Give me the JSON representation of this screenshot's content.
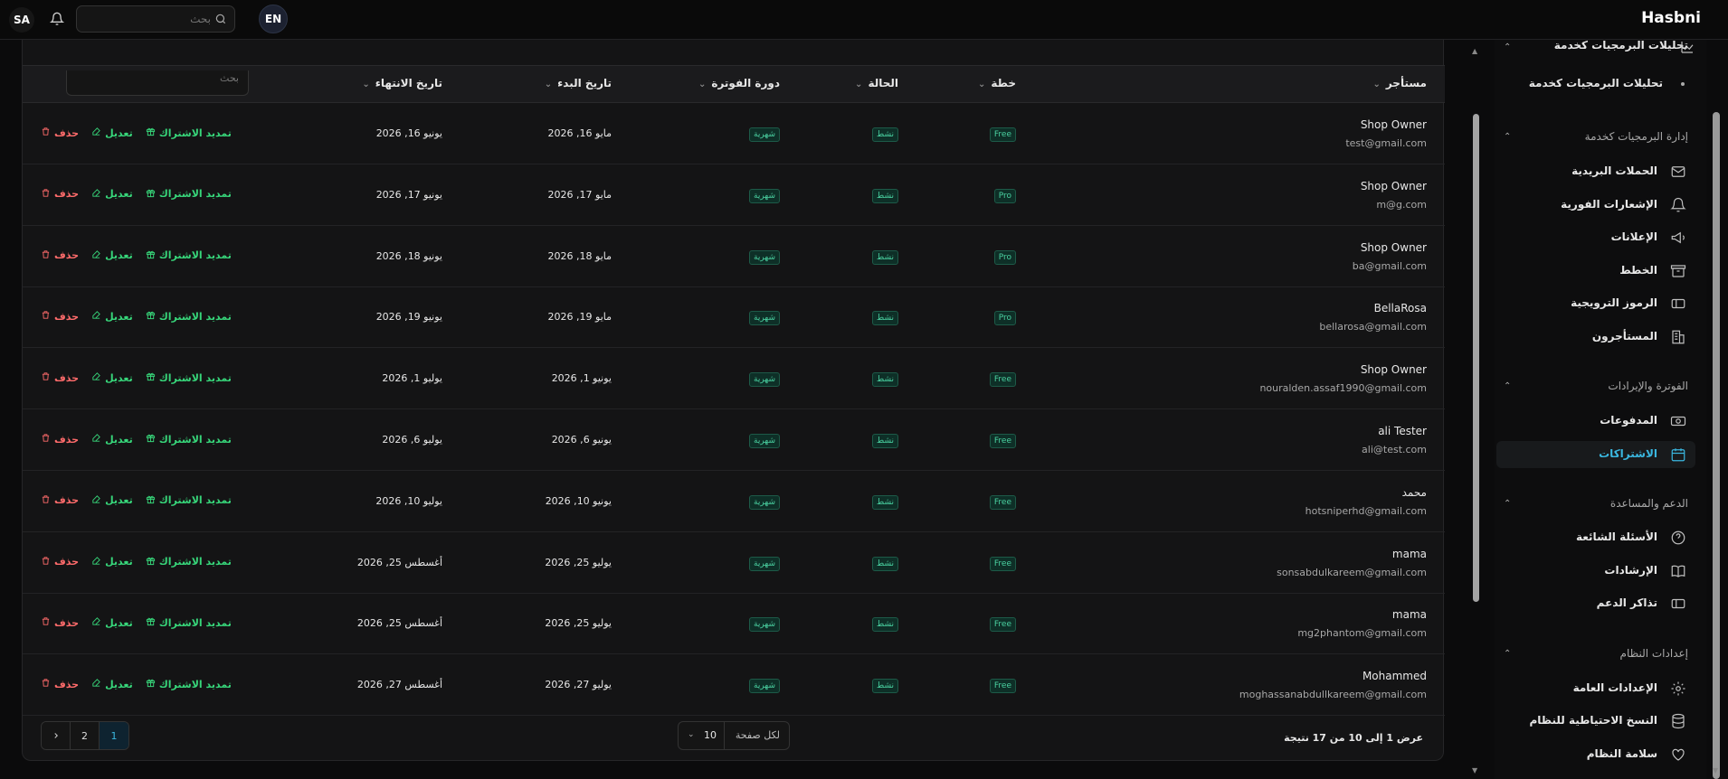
{
  "app": {
    "brand": "Hasbni",
    "user_initials": "SA",
    "lang": "EN"
  },
  "topbar": {
    "search_placeholder": "بحث"
  },
  "table": {
    "search_placeholder": "بحث",
    "headers": {
      "tenant": "مستأجر",
      "plan": "خطة",
      "status": "الحالة",
      "cycle": "دورة الفوترة",
      "start": "تاريخ البدء",
      "end": "تاريخ الانتهاء"
    },
    "rows": [
      {
        "name": "Shop Owner",
        "email": "test@gmail.com",
        "plan": "Free",
        "status": "نشط",
        "cycle": "شهرية",
        "start": "مايو 16, 2026",
        "end": "يونيو 16, 2026"
      },
      {
        "name": "Shop Owner",
        "email": "m@g.com",
        "plan": "Pro",
        "status": "نشط",
        "cycle": "شهرية",
        "start": "مايو 17, 2026",
        "end": "يونيو 17, 2026"
      },
      {
        "name": "Shop Owner",
        "email": "ba@gmail.com",
        "plan": "Pro",
        "status": "نشط",
        "cycle": "شهرية",
        "start": "مايو 18, 2026",
        "end": "يونيو 18, 2026"
      },
      {
        "name": "BellaRosa",
        "email": "bellarosa@gmail.com",
        "plan": "Pro",
        "status": "نشط",
        "cycle": "شهرية",
        "start": "مايو 19, 2026",
        "end": "يونيو 19, 2026"
      },
      {
        "name": "Shop Owner",
        "email": "nouralden.assaf1990@gmail.com",
        "plan": "Free",
        "status": "نشط",
        "cycle": "شهرية",
        "start": "يونيو 1, 2026",
        "end": "يوليو 1, 2026"
      },
      {
        "name": "ali Tester",
        "email": "ali@test.com",
        "plan": "Free",
        "status": "نشط",
        "cycle": "شهرية",
        "start": "يونيو 6, 2026",
        "end": "يوليو 6, 2026"
      },
      {
        "name": "محمد",
        "email": "hotsniperhd@gmail.com",
        "plan": "Free",
        "status": "نشط",
        "cycle": "شهرية",
        "start": "يونيو 10, 2026",
        "end": "يوليو 10, 2026"
      },
      {
        "name": "mama",
        "email": "sonsabdulkareem@gmail.com",
        "plan": "Free",
        "status": "نشط",
        "cycle": "شهرية",
        "start": "يوليو 25, 2026",
        "end": "أغسطس 25, 2026"
      },
      {
        "name": "mama",
        "email": "mg2phantom@gmail.com",
        "plan": "Free",
        "status": "نشط",
        "cycle": "شهرية",
        "start": "يوليو 25, 2026",
        "end": "أغسطس 25, 2026"
      },
      {
        "name": "Mohammed",
        "email": "moghassanabdullkareem@gmail.com",
        "plan": "Free",
        "status": "نشط",
        "cycle": "شهرية",
        "start": "يوليو 27, 2026",
        "end": "أغسطس 27, 2026"
      }
    ],
    "actions": {
      "extend": "تمديد الاشتراك",
      "edit": "تعديل",
      "delete": "حذف"
    }
  },
  "footer": {
    "results_text": "عرض 1 إلى 10 من 17 نتيجة",
    "per_page_label": "لكل صفحة",
    "per_page_value": "10",
    "pages": [
      "1",
      "2"
    ]
  },
  "sidebar": {
    "items_top": [
      {
        "label": "تحليلات البرمجيات كخدمة",
        "icon": "chart-icon",
        "kind": "section-partial"
      },
      {
        "label": "تحليلات البرمجيات كخدمة",
        "icon": "dot",
        "kind": "subitem"
      }
    ],
    "sections": [
      {
        "title": "إدارة البرمجيات كخدمة",
        "items": [
          {
            "label": "الحملات البريدية",
            "icon": "mail-icon"
          },
          {
            "label": "الإشعارات الفورية",
            "icon": "bell-icon"
          },
          {
            "label": "الإعلانات",
            "icon": "megaphone-icon"
          },
          {
            "label": "الخطط",
            "icon": "box-icon"
          },
          {
            "label": "الرموز الترويجية",
            "icon": "ticket-icon"
          },
          {
            "label": "المستأجرون",
            "icon": "building-icon"
          }
        ]
      },
      {
        "title": "الفوترة والإيرادات",
        "items": [
          {
            "label": "المدفوعات",
            "icon": "cash-icon"
          },
          {
            "label": "الاشتراكات",
            "icon": "calendar-icon",
            "active": true
          }
        ]
      },
      {
        "title": "الدعم والمساعدة",
        "items": [
          {
            "label": "الأسئلة الشائعة",
            "icon": "help-icon"
          },
          {
            "label": "الإرشادات",
            "icon": "book-icon"
          },
          {
            "label": "تذاكر الدعم",
            "icon": "ticket-icon"
          }
        ]
      },
      {
        "title": "إعدادات النظام",
        "items": [
          {
            "label": "الإعدادات العامة",
            "icon": "gear-icon"
          },
          {
            "label": "النسخ الاحتياطية للنظام",
            "icon": "database-icon"
          },
          {
            "label": "سلامة النظام",
            "icon": "heart-icon"
          }
        ]
      }
    ]
  },
  "colors": {
    "accent": "#3ab7e0",
    "green": "#37d67a",
    "red": "#ff6b6b",
    "badge_bg": "#0e2f27"
  }
}
